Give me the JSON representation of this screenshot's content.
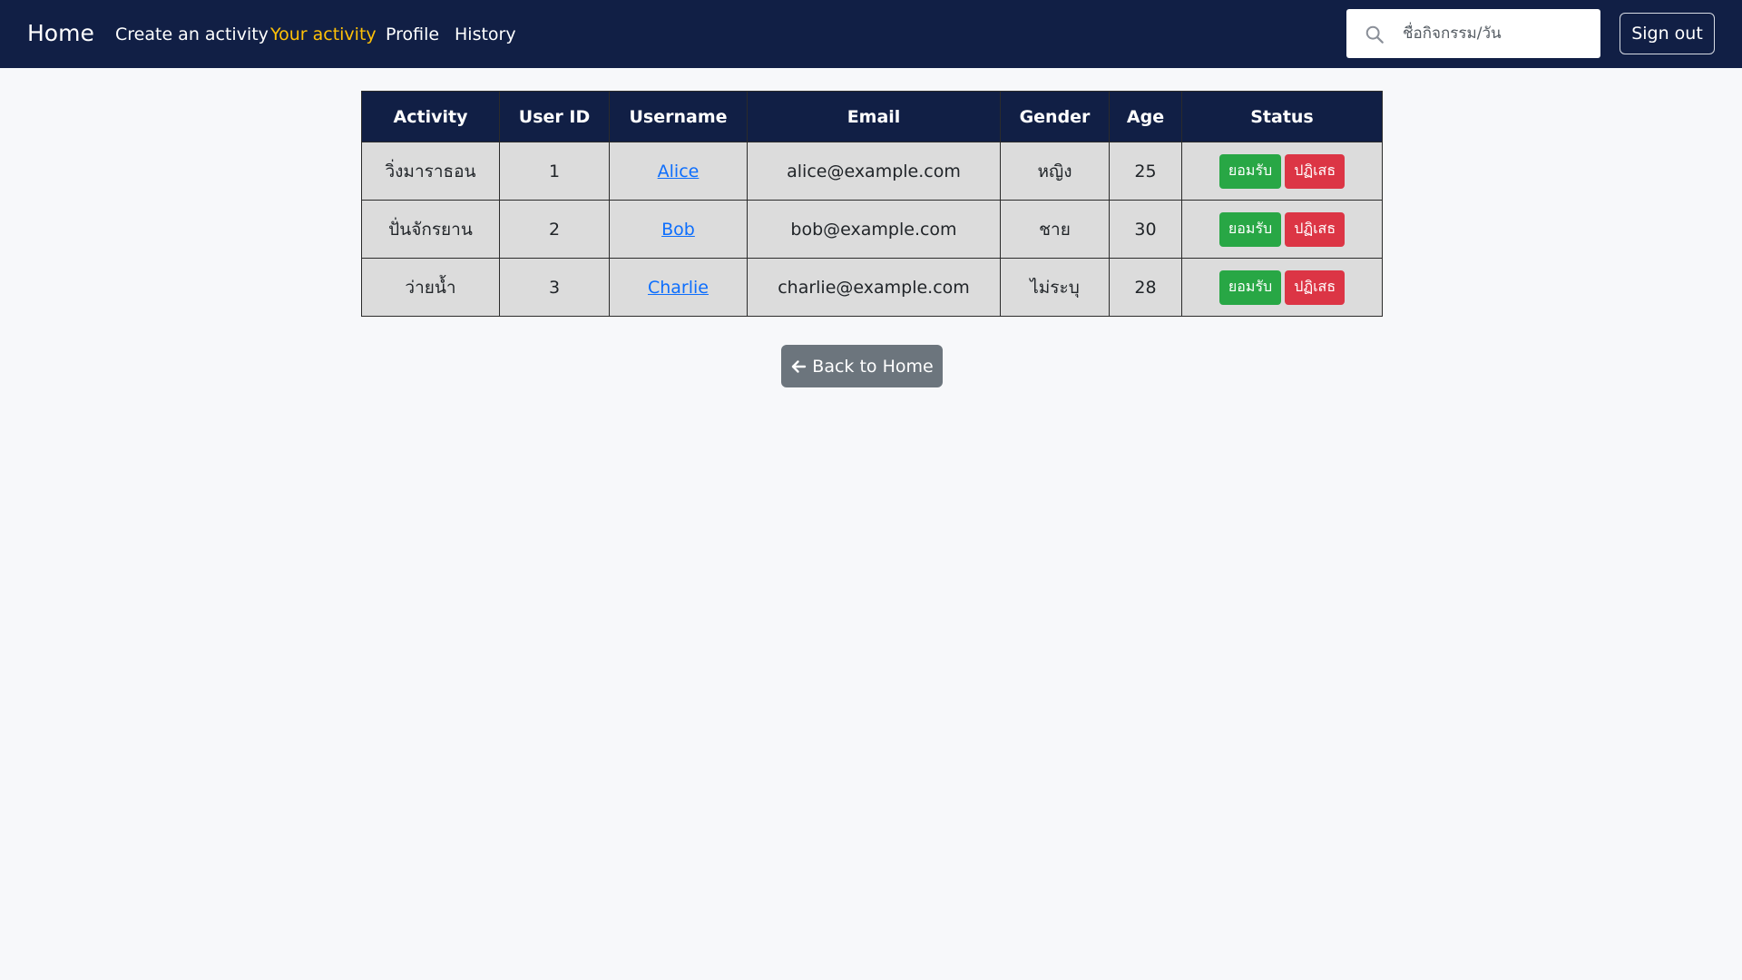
{
  "nav": {
    "brand": "Home",
    "links": [
      {
        "label": "Create an activity",
        "active": false
      },
      {
        "label": "Your activity",
        "active": true
      },
      {
        "label": "Profile",
        "active": false
      },
      {
        "label": "History",
        "active": false
      }
    ],
    "search": {
      "placeholder": "ชื่อกิจกรรม/วัน",
      "value": "",
      "icon": "search-icon"
    },
    "signout_label": "Sign out"
  },
  "table": {
    "headers": [
      "Activity",
      "User ID",
      "Username",
      "Email",
      "Gender",
      "Age",
      "Status"
    ],
    "rows": [
      {
        "activity": "วิ่งมาราธอน",
        "user_id": "1",
        "username": "Alice",
        "email": "alice@example.com",
        "gender": "หญิง",
        "age": "25"
      },
      {
        "activity": "ปั่นจักรยาน",
        "user_id": "2",
        "username": "Bob",
        "email": "bob@example.com",
        "gender": "ชาย",
        "age": "30"
      },
      {
        "activity": "ว่ายน้ำ",
        "user_id": "3",
        "username": "Charlie",
        "email": "charlie@example.com",
        "gender": "ไม่ระบุ",
        "age": "28"
      }
    ],
    "accept_label": "ยอมรับ",
    "reject_label": "ปฏิเสธ"
  },
  "back_button": {
    "label": "Back to Home",
    "icon": "arrow-left-icon"
  },
  "colors": {
    "navbar": "#111f45",
    "active_link": "#ffc107",
    "accept": "#28a745",
    "reject": "#dc3545",
    "back": "#6c757d"
  }
}
